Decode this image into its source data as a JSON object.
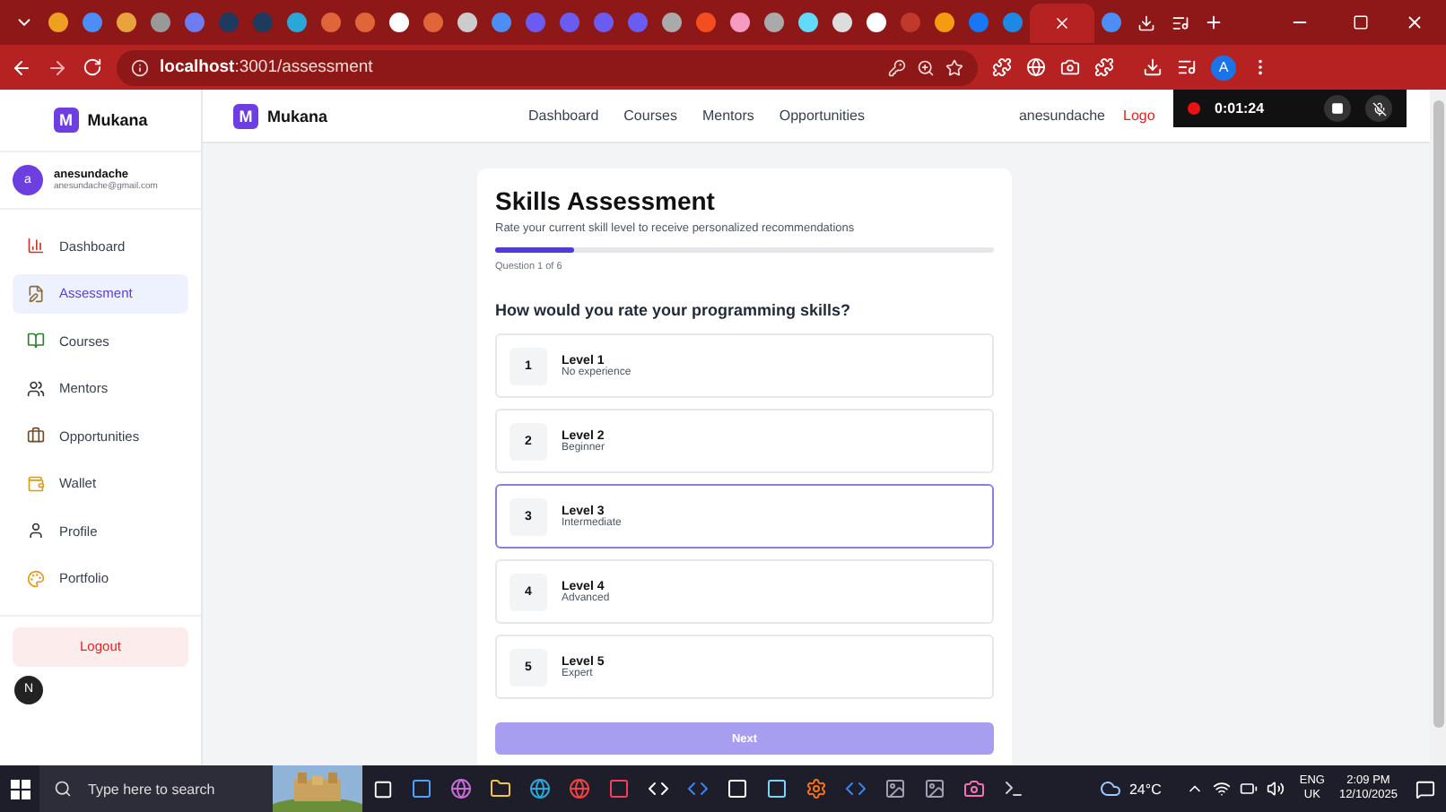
{
  "browser": {
    "tabs": [
      {
        "selected": false
      },
      {
        "selected": false
      },
      {
        "selected": false
      },
      {
        "selected": false
      },
      {
        "selected": false
      },
      {
        "selected": false
      },
      {
        "selected": false
      },
      {
        "selected": false
      },
      {
        "selected": false
      },
      {
        "selected": false
      },
      {
        "selected": false
      },
      {
        "selected": false
      },
      {
        "selected": false
      },
      {
        "selected": false
      },
      {
        "selected": false
      },
      {
        "selected": false
      },
      {
        "selected": false
      },
      {
        "selected": false
      },
      {
        "selected": false
      },
      {
        "selected": false
      },
      {
        "selected": false
      },
      {
        "selected": false
      },
      {
        "selected": false
      },
      {
        "selected": false
      },
      {
        "selected": false
      },
      {
        "selected": false
      },
      {
        "selected": false
      },
      {
        "selected": false
      },
      {
        "selected": false
      },
      {
        "selected": true
      },
      {
        "selected": false
      }
    ],
    "url_host": "localhost",
    "url_path": ":3001/assessment",
    "profile": "A"
  },
  "header": {
    "logo": "M",
    "brand": "Mukana",
    "nav": [
      "Dashboard",
      "Courses",
      "Mentors",
      "Opportunities"
    ],
    "user": "anesundache",
    "logout": "Logo"
  },
  "recording": {
    "time": "0:01:24"
  },
  "sidebar": {
    "logo": "M",
    "brand": "Mukana",
    "avatar": "a",
    "name": "anesundache",
    "email": "anesundache@gmail.com",
    "items": [
      {
        "label": "Dashboard",
        "selected": false
      },
      {
        "label": "Assessment",
        "selected": true
      },
      {
        "label": "Courses",
        "selected": false
      },
      {
        "label": "Mentors",
        "selected": false
      },
      {
        "label": "Opportunities",
        "selected": false
      },
      {
        "label": "Wallet",
        "selected": false
      },
      {
        "label": "Profile",
        "selected": false
      },
      {
        "label": "Portfolio",
        "selected": false
      }
    ],
    "logout": "Logout",
    "badge": "N"
  },
  "assessment": {
    "title": "Skills Assessment",
    "subtitle": "Rate your current skill level to receive personalized recommendations",
    "progress": {
      "level": 0.16
    },
    "step": "Question 1 of 6",
    "question": "How would you rate your programming skills?",
    "options": [
      {
        "number": "1",
        "title": "Level 1",
        "description": "No experience",
        "selected": false
      },
      {
        "number": "2",
        "title": "Level 2",
        "description": "Beginner",
        "selected": false
      },
      {
        "number": "3",
        "title": "Level 3",
        "description": "Intermediate",
        "selected": true
      },
      {
        "number": "4",
        "title": "Level 4",
        "description": "Advanced",
        "selected": false
      },
      {
        "number": "5",
        "title": "Level 5",
        "description": "Expert",
        "selected": false
      }
    ],
    "next": {
      "label": "Next",
      "disabled": true
    }
  },
  "taskbar": {
    "search": {
      "placeholder": "Type here to search"
    },
    "weather": "24°C",
    "language": "ENG",
    "region": "UK",
    "time": "2:09 PM",
    "date": "12/10/2025"
  }
}
